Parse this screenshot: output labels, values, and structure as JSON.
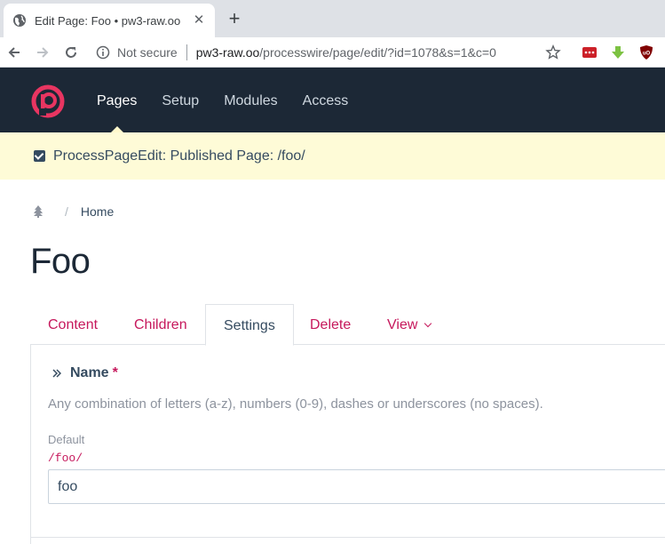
{
  "browser": {
    "tab_title": "Edit Page: Foo • pw3-raw.oo",
    "tab_close": "✕",
    "new_tab": "+",
    "security_label": "Not secure",
    "url_host": "pw3-raw.oo",
    "url_path": "/processwire/page/edit/?id=1078&s=1&c=0"
  },
  "masthead": {
    "nav": [
      {
        "label": "Pages",
        "active": true
      },
      {
        "label": "Setup",
        "active": false
      },
      {
        "label": "Modules",
        "active": false
      },
      {
        "label": "Access",
        "active": false
      }
    ]
  },
  "notice": {
    "text": "ProcessPageEdit: Published Page: /foo/"
  },
  "breadcrumbs": {
    "separator": "/",
    "home": "Home"
  },
  "page": {
    "title": "Foo"
  },
  "tabs": [
    {
      "label": "Content",
      "active": false
    },
    {
      "label": "Children",
      "active": false
    },
    {
      "label": "Settings",
      "active": true
    },
    {
      "label": "Delete",
      "active": false
    },
    {
      "label": "View",
      "active": false
    }
  ],
  "field": {
    "label": "Name",
    "required_marker": "*",
    "description": "Any combination of letters (a-z), numbers (0-9), dashes or underscores (no spaces).",
    "language_label": "Default",
    "path_preview": "/foo/",
    "value": "foo"
  },
  "colors": {
    "masthead": "#1c2836",
    "accent": "#c6185c",
    "notice_bg": "#fefbd7"
  }
}
